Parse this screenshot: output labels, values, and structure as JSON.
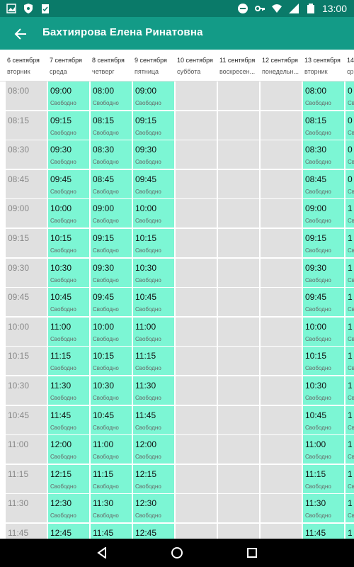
{
  "status": {
    "time": "13:00"
  },
  "appbar": {
    "title": "Бахтиярова Елена Ринатовна"
  },
  "days": [
    {
      "date": "6 сентября",
      "weekday": "вторник"
    },
    {
      "date": "7 сентября",
      "weekday": "среда"
    },
    {
      "date": "8 сентября",
      "weekday": "четверг"
    },
    {
      "date": "9 сентября",
      "weekday": "пятница"
    },
    {
      "date": "10 сентября",
      "weekday": "суббота"
    },
    {
      "date": "11 сентября",
      "weekday": "воскресен..."
    },
    {
      "date": "12 сентября",
      "weekday": "понедельн..."
    },
    {
      "date": "13 сентября",
      "weekday": "вторник"
    },
    {
      "date": "14",
      "weekday": "ср"
    }
  ],
  "slot_status": "Свободно",
  "rows": [
    {
      "time": "08:00",
      "cells": [
        "09:00",
        "08:00",
        "09:00",
        null,
        null,
        null,
        "08:00",
        "0"
      ]
    },
    {
      "time": "08:15",
      "cells": [
        "09:15",
        "08:15",
        "09:15",
        null,
        null,
        null,
        "08:15",
        "0"
      ]
    },
    {
      "time": "08:30",
      "cells": [
        "09:30",
        "08:30",
        "09:30",
        null,
        null,
        null,
        "08:30",
        "0"
      ]
    },
    {
      "time": "08:45",
      "cells": [
        "09:45",
        "08:45",
        "09:45",
        null,
        null,
        null,
        "08:45",
        "0"
      ]
    },
    {
      "time": "09:00",
      "cells": [
        "10:00",
        "09:00",
        "10:00",
        null,
        null,
        null,
        "09:00",
        "1"
      ]
    },
    {
      "time": "09:15",
      "cells": [
        "10:15",
        "09:15",
        "10:15",
        null,
        null,
        null,
        "09:15",
        "1"
      ]
    },
    {
      "time": "09:30",
      "cells": [
        "10:30",
        "09:30",
        "10:30",
        null,
        null,
        null,
        "09:30",
        "1"
      ]
    },
    {
      "time": "09:45",
      "cells": [
        "10:45",
        "09:45",
        "10:45",
        null,
        null,
        null,
        "09:45",
        "1"
      ]
    },
    {
      "time": "10:00",
      "cells": [
        "11:00",
        "10:00",
        "11:00",
        null,
        null,
        null,
        "10:00",
        "1"
      ]
    },
    {
      "time": "10:15",
      "cells": [
        "11:15",
        "10:15",
        "11:15",
        null,
        null,
        null,
        "10:15",
        "1"
      ]
    },
    {
      "time": "10:30",
      "cells": [
        "11:30",
        "10:30",
        "11:30",
        null,
        null,
        null,
        "10:30",
        "1"
      ]
    },
    {
      "time": "10:45",
      "cells": [
        "11:45",
        "10:45",
        "11:45",
        null,
        null,
        null,
        "10:45",
        "1"
      ]
    },
    {
      "time": "11:00",
      "cells": [
        "12:00",
        "11:00",
        "12:00",
        null,
        null,
        null,
        "11:00",
        "1"
      ]
    },
    {
      "time": "11:15",
      "cells": [
        "12:15",
        "11:15",
        "12:15",
        null,
        null,
        null,
        "11:15",
        "1"
      ]
    },
    {
      "time": "11:30",
      "cells": [
        "12:30",
        "11:30",
        "12:30",
        null,
        null,
        null,
        "11:30",
        "1"
      ]
    },
    {
      "time": "11:45",
      "cells": [
        "12:45",
        "11:45",
        "12:45",
        null,
        null,
        null,
        "11:45",
        "1"
      ]
    }
  ],
  "colors": {
    "free_slot": "#7cf6d4",
    "empty_slot": "#e0e0e0",
    "appbar": "#139b87",
    "statusbar": "#0a7a69"
  }
}
